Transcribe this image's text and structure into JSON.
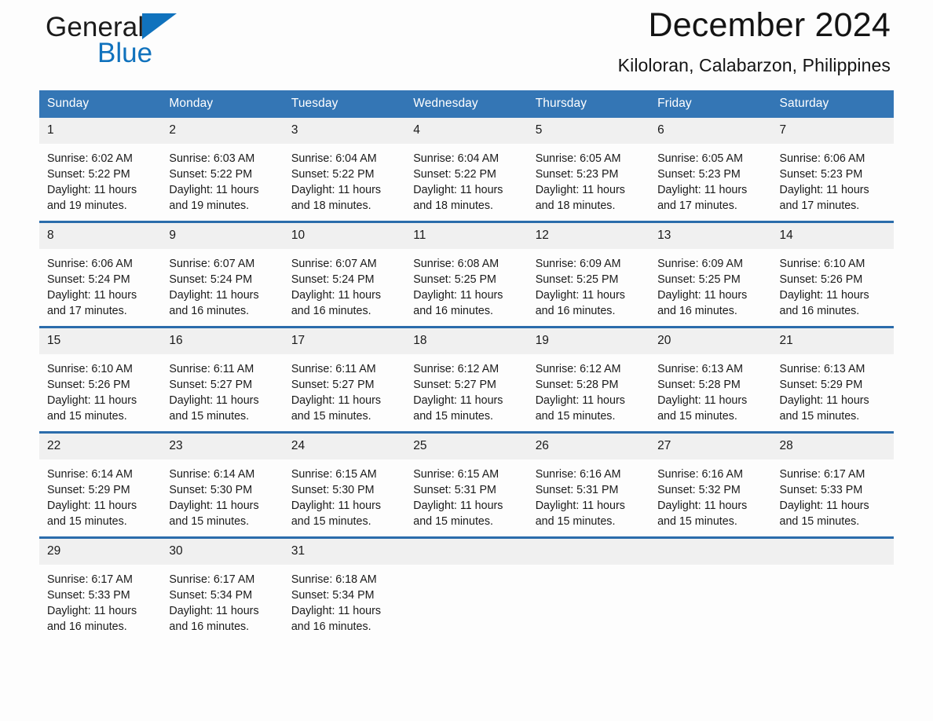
{
  "brand": {
    "name_part1": "General",
    "name_part2": "Blue",
    "triangle_color": "#1072bd",
    "accent_color": "#3476b5"
  },
  "header": {
    "title": "December 2024",
    "subtitle": "Kiloloran, Calabarzon, Philippines"
  },
  "weekday_headers": [
    "Sunday",
    "Monday",
    "Tuesday",
    "Wednesday",
    "Thursday",
    "Friday",
    "Saturday"
  ],
  "labels": {
    "sunrise_prefix": "Sunrise: ",
    "sunset_prefix": "Sunset: ",
    "daylight_prefix": "Daylight: "
  },
  "weeks": [
    [
      {
        "day": "1",
        "sunrise": "Sunrise: 6:02 AM",
        "sunset": "Sunset: 5:22 PM",
        "daylight": "Daylight: 11 hours and 19 minutes."
      },
      {
        "day": "2",
        "sunrise": "Sunrise: 6:03 AM",
        "sunset": "Sunset: 5:22 PM",
        "daylight": "Daylight: 11 hours and 19 minutes."
      },
      {
        "day": "3",
        "sunrise": "Sunrise: 6:04 AM",
        "sunset": "Sunset: 5:22 PM",
        "daylight": "Daylight: 11 hours and 18 minutes."
      },
      {
        "day": "4",
        "sunrise": "Sunrise: 6:04 AM",
        "sunset": "Sunset: 5:22 PM",
        "daylight": "Daylight: 11 hours and 18 minutes."
      },
      {
        "day": "5",
        "sunrise": "Sunrise: 6:05 AM",
        "sunset": "Sunset: 5:23 PM",
        "daylight": "Daylight: 11 hours and 18 minutes."
      },
      {
        "day": "6",
        "sunrise": "Sunrise: 6:05 AM",
        "sunset": "Sunset: 5:23 PM",
        "daylight": "Daylight: 11 hours and 17 minutes."
      },
      {
        "day": "7",
        "sunrise": "Sunrise: 6:06 AM",
        "sunset": "Sunset: 5:23 PM",
        "daylight": "Daylight: 11 hours and 17 minutes."
      }
    ],
    [
      {
        "day": "8",
        "sunrise": "Sunrise: 6:06 AM",
        "sunset": "Sunset: 5:24 PM",
        "daylight": "Daylight: 11 hours and 17 minutes."
      },
      {
        "day": "9",
        "sunrise": "Sunrise: 6:07 AM",
        "sunset": "Sunset: 5:24 PM",
        "daylight": "Daylight: 11 hours and 16 minutes."
      },
      {
        "day": "10",
        "sunrise": "Sunrise: 6:07 AM",
        "sunset": "Sunset: 5:24 PM",
        "daylight": "Daylight: 11 hours and 16 minutes."
      },
      {
        "day": "11",
        "sunrise": "Sunrise: 6:08 AM",
        "sunset": "Sunset: 5:25 PM",
        "daylight": "Daylight: 11 hours and 16 minutes."
      },
      {
        "day": "12",
        "sunrise": "Sunrise: 6:09 AM",
        "sunset": "Sunset: 5:25 PM",
        "daylight": "Daylight: 11 hours and 16 minutes."
      },
      {
        "day": "13",
        "sunrise": "Sunrise: 6:09 AM",
        "sunset": "Sunset: 5:25 PM",
        "daylight": "Daylight: 11 hours and 16 minutes."
      },
      {
        "day": "14",
        "sunrise": "Sunrise: 6:10 AM",
        "sunset": "Sunset: 5:26 PM",
        "daylight": "Daylight: 11 hours and 16 minutes."
      }
    ],
    [
      {
        "day": "15",
        "sunrise": "Sunrise: 6:10 AM",
        "sunset": "Sunset: 5:26 PM",
        "daylight": "Daylight: 11 hours and 15 minutes."
      },
      {
        "day": "16",
        "sunrise": "Sunrise: 6:11 AM",
        "sunset": "Sunset: 5:27 PM",
        "daylight": "Daylight: 11 hours and 15 minutes."
      },
      {
        "day": "17",
        "sunrise": "Sunrise: 6:11 AM",
        "sunset": "Sunset: 5:27 PM",
        "daylight": "Daylight: 11 hours and 15 minutes."
      },
      {
        "day": "18",
        "sunrise": "Sunrise: 6:12 AM",
        "sunset": "Sunset: 5:27 PM",
        "daylight": "Daylight: 11 hours and 15 minutes."
      },
      {
        "day": "19",
        "sunrise": "Sunrise: 6:12 AM",
        "sunset": "Sunset: 5:28 PM",
        "daylight": "Daylight: 11 hours and 15 minutes."
      },
      {
        "day": "20",
        "sunrise": "Sunrise: 6:13 AM",
        "sunset": "Sunset: 5:28 PM",
        "daylight": "Daylight: 11 hours and 15 minutes."
      },
      {
        "day": "21",
        "sunrise": "Sunrise: 6:13 AM",
        "sunset": "Sunset: 5:29 PM",
        "daylight": "Daylight: 11 hours and 15 minutes."
      }
    ],
    [
      {
        "day": "22",
        "sunrise": "Sunrise: 6:14 AM",
        "sunset": "Sunset: 5:29 PM",
        "daylight": "Daylight: 11 hours and 15 minutes."
      },
      {
        "day": "23",
        "sunrise": "Sunrise: 6:14 AM",
        "sunset": "Sunset: 5:30 PM",
        "daylight": "Daylight: 11 hours and 15 minutes."
      },
      {
        "day": "24",
        "sunrise": "Sunrise: 6:15 AM",
        "sunset": "Sunset: 5:30 PM",
        "daylight": "Daylight: 11 hours and 15 minutes."
      },
      {
        "day": "25",
        "sunrise": "Sunrise: 6:15 AM",
        "sunset": "Sunset: 5:31 PM",
        "daylight": "Daylight: 11 hours and 15 minutes."
      },
      {
        "day": "26",
        "sunrise": "Sunrise: 6:16 AM",
        "sunset": "Sunset: 5:31 PM",
        "daylight": "Daylight: 11 hours and 15 minutes."
      },
      {
        "day": "27",
        "sunrise": "Sunrise: 6:16 AM",
        "sunset": "Sunset: 5:32 PM",
        "daylight": "Daylight: 11 hours and 15 minutes."
      },
      {
        "day": "28",
        "sunrise": "Sunrise: 6:17 AM",
        "sunset": "Sunset: 5:33 PM",
        "daylight": "Daylight: 11 hours and 15 minutes."
      }
    ],
    [
      {
        "day": "29",
        "sunrise": "Sunrise: 6:17 AM",
        "sunset": "Sunset: 5:33 PM",
        "daylight": "Daylight: 11 hours and 16 minutes."
      },
      {
        "day": "30",
        "sunrise": "Sunrise: 6:17 AM",
        "sunset": "Sunset: 5:34 PM",
        "daylight": "Daylight: 11 hours and 16 minutes."
      },
      {
        "day": "31",
        "sunrise": "Sunrise: 6:18 AM",
        "sunset": "Sunset: 5:34 PM",
        "daylight": "Daylight: 11 hours and 16 minutes."
      },
      {
        "day": "",
        "sunrise": "",
        "sunset": "",
        "daylight": ""
      },
      {
        "day": "",
        "sunrise": "",
        "sunset": "",
        "daylight": ""
      },
      {
        "day": "",
        "sunrise": "",
        "sunset": "",
        "daylight": ""
      },
      {
        "day": "",
        "sunrise": "",
        "sunset": "",
        "daylight": ""
      }
    ]
  ]
}
